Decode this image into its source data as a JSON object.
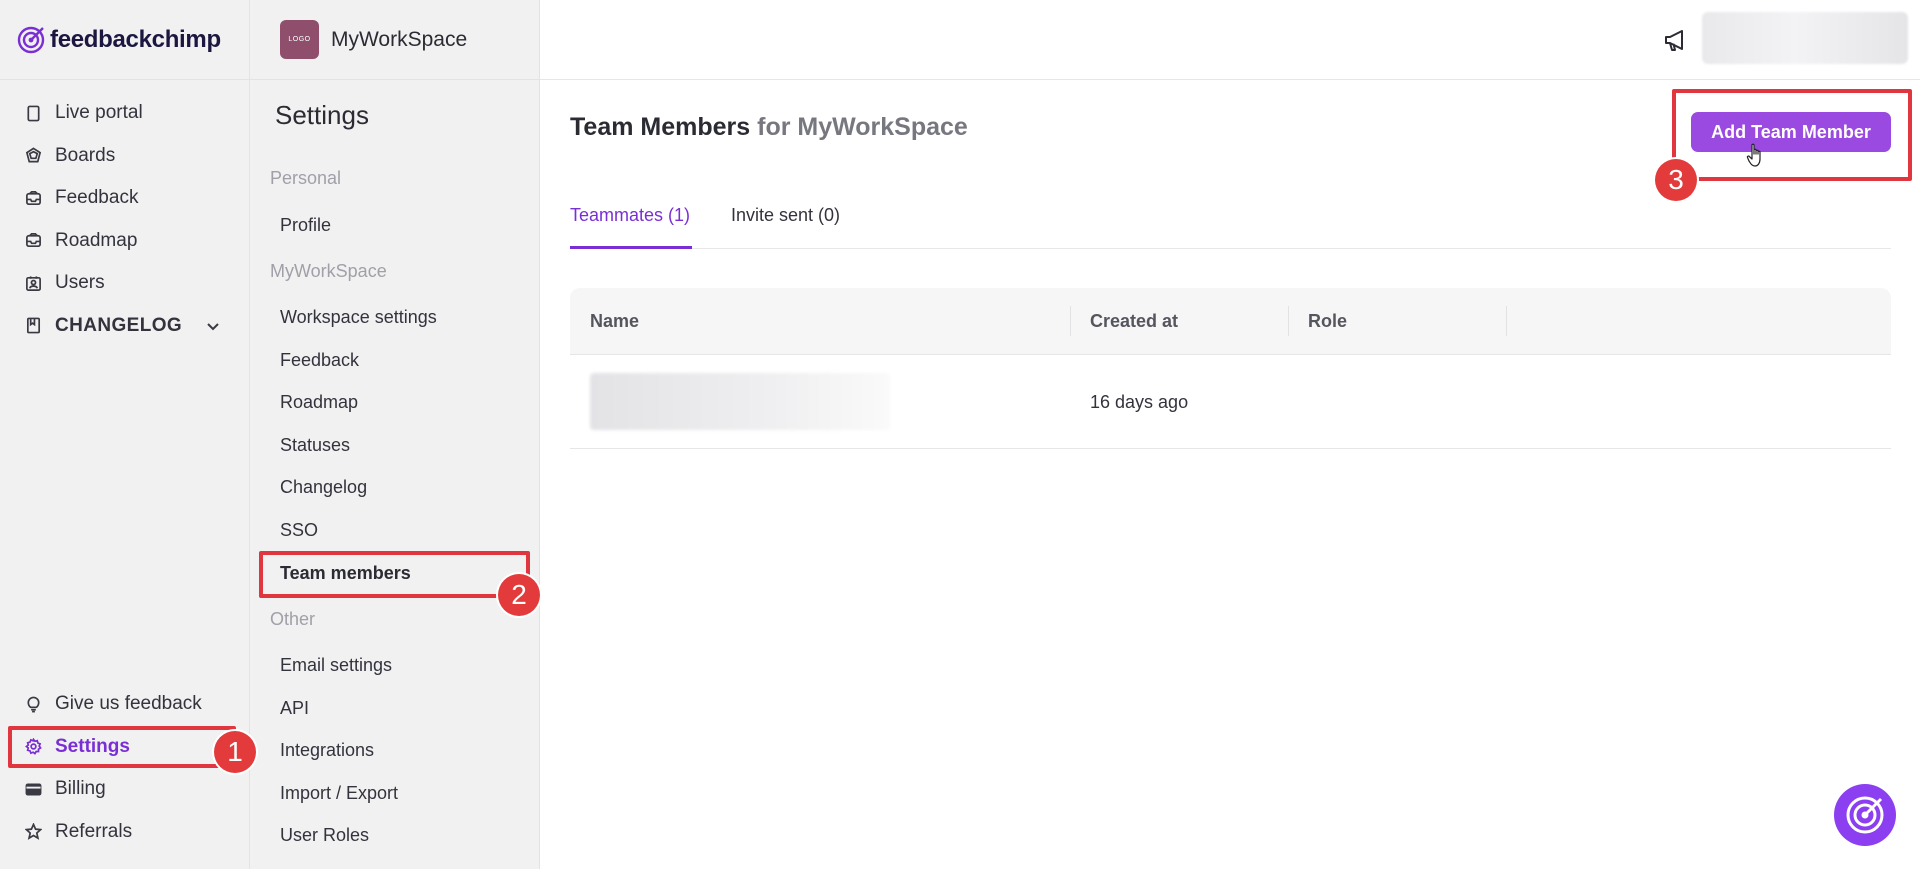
{
  "brand": {
    "name": "feedbackchimp"
  },
  "nav": {
    "items": [
      {
        "label": "Live portal",
        "icon": "document-icon"
      },
      {
        "label": "Boards",
        "icon": "boards-icon"
      },
      {
        "label": "Feedback",
        "icon": "inbox-icon"
      },
      {
        "label": "Roadmap",
        "icon": "inbox-icon"
      },
      {
        "label": "Users",
        "icon": "users-icon"
      },
      {
        "label": "CHANGELOG",
        "icon": "book-icon"
      }
    ],
    "bottom": [
      {
        "label": "Give us feedback",
        "icon": "lightbulb-icon"
      },
      {
        "label": "Settings",
        "icon": "gear-icon"
      },
      {
        "label": "Billing",
        "icon": "card-icon"
      },
      {
        "label": "Referrals",
        "icon": "star-icon"
      }
    ]
  },
  "workspace": {
    "logo_text": "LOGO",
    "name": "MyWorkSpace"
  },
  "settings": {
    "title": "Settings",
    "groups": {
      "personal": "Personal",
      "workspace": "MyWorkSpace",
      "other": "Other"
    },
    "personal_items": [
      "Profile"
    ],
    "workspace_items": [
      "Workspace settings",
      "Feedback",
      "Roadmap",
      "Statuses",
      "Changelog",
      "SSO",
      "Team members"
    ],
    "other_items": [
      "Email settings",
      "API",
      "Integrations",
      "Import / Export",
      "User Roles"
    ]
  },
  "page": {
    "title": "Team Members",
    "subtitle": "for MyWorkSpace",
    "add_button": "Add Team Member"
  },
  "tabs": [
    {
      "label": "Teammates (1)"
    },
    {
      "label": "Invite sent (0)"
    }
  ],
  "table": {
    "columns": [
      "Name",
      "Created at",
      "Role"
    ],
    "rows": [
      {
        "created_at": "16 days ago",
        "role": ""
      }
    ]
  },
  "annotations": [
    "1",
    "2",
    "3"
  ],
  "colors": {
    "accent": "#7a2fd4",
    "button": "#9a4ae0",
    "annotation": "#e0363f"
  }
}
